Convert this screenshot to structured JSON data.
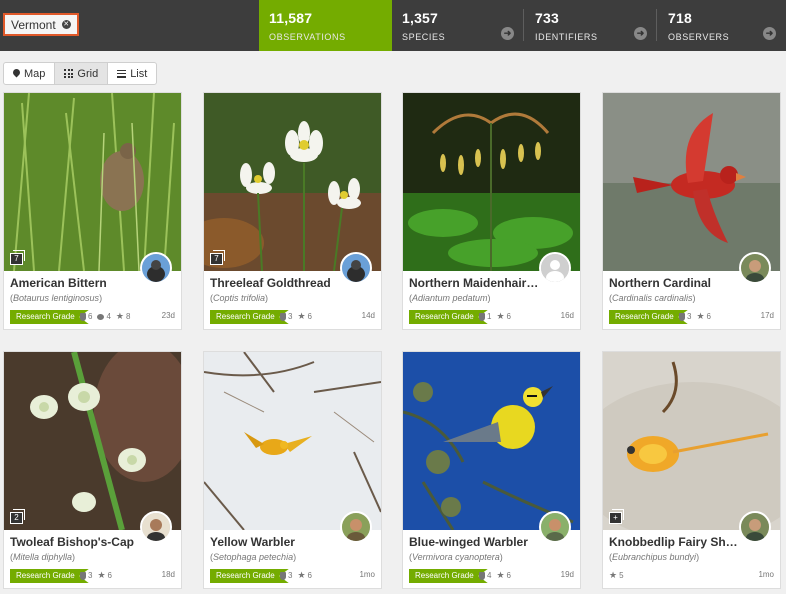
{
  "place": {
    "label": "Vermont"
  },
  "stats": [
    {
      "number": "11,587",
      "label": "OBSERVATIONS"
    },
    {
      "number": "1,357",
      "label": "SPECIES"
    },
    {
      "number": "733",
      "label": "IDENTIFIERS"
    },
    {
      "number": "718",
      "label": "OBSERVERS"
    }
  ],
  "views": [
    {
      "label": "Map",
      "icon": "map-pin-icon"
    },
    {
      "label": "Grid",
      "icon": "grid-icon"
    },
    {
      "label": "List",
      "icon": "list-icon"
    }
  ],
  "colors": {
    "accent": "#74ac00",
    "topbar": "#3d3d3d",
    "chip_border": "#e0592a"
  },
  "cards": [
    {
      "name": "American Bittern",
      "scientific": "Botaurus lentiginosus",
      "photo_count": "7",
      "grade": "Research Grade",
      "ids": "6",
      "comments": "4",
      "faves": "8",
      "age": "23d"
    },
    {
      "name": "Threeleaf Goldthread",
      "scientific": "Coptis trifolia",
      "photo_count": "7",
      "grade": "Research Grade",
      "ids": "3",
      "faves": "6",
      "age": "14d"
    },
    {
      "name": "Northern Maidenhair F...",
      "scientific": "Adiantum pedatum",
      "grade": "Research Grade",
      "ids": "1",
      "faves": "6",
      "age": "16d"
    },
    {
      "name": "Northern Cardinal",
      "scientific": "Cardinalis cardinalis",
      "grade": "Research Grade",
      "ids": "3",
      "faves": "6",
      "age": "17d"
    },
    {
      "name": "Twoleaf Bishop's-Cap",
      "scientific": "Mitella diphylla",
      "photo_count": "2",
      "grade": "Research Grade",
      "ids": "3",
      "faves": "6",
      "age": "18d"
    },
    {
      "name": "Yellow Warbler",
      "scientific": "Setophaga petechia",
      "grade": "Research Grade",
      "ids": "3",
      "faves": "6",
      "age": "1mo"
    },
    {
      "name": "Blue-winged Warbler",
      "scientific": "Vermivora cyanoptera",
      "grade": "Research Grade",
      "ids": "4",
      "faves": "6",
      "age": "19d"
    },
    {
      "name": "Knobbedlip Fairy Shrimp",
      "scientific": "Eubranchipus bundyi",
      "photo_count": "+",
      "faves": "5",
      "age": "1mo"
    }
  ]
}
